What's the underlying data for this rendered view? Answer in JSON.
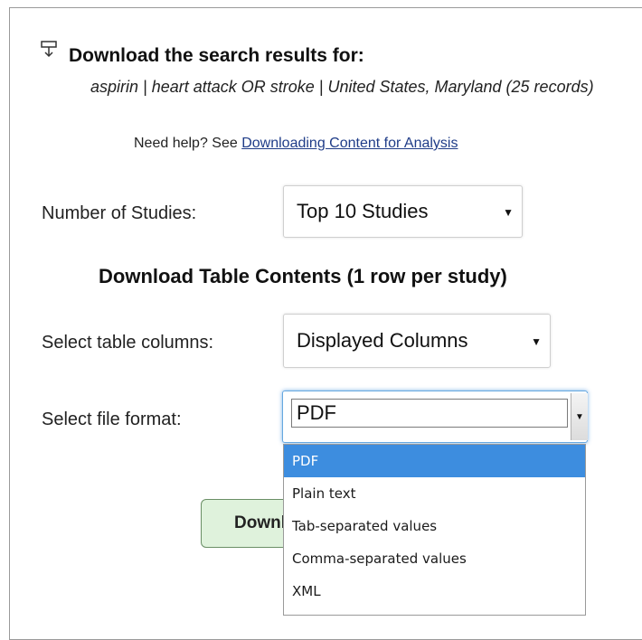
{
  "header": {
    "title": "Download the search results for:",
    "query": "aspirin | heart attack OR stroke | United States, Maryland (25 records)",
    "help_prefix": "Need help? See",
    "help_link": "Downloading Content for Analysis"
  },
  "number_of_studies": {
    "label": "Number of Studies:",
    "value": "Top 10 Studies"
  },
  "section_heading": "Download Table Contents (1 row per study)",
  "table_columns": {
    "label": "Select table columns:",
    "value": "Displayed Columns"
  },
  "file_format": {
    "label": "Select file format:",
    "value": "PDF",
    "options": [
      "PDF",
      "Plain text",
      "Tab-separated values",
      "Comma-separated values",
      "XML"
    ],
    "selected_index": 0
  },
  "download_button": {
    "label": "Download"
  },
  "colors": {
    "link": "#1f3c88",
    "highlight": "#3d8ddf",
    "button_bg": "#dff2dc",
    "focus": "#66a8e0"
  },
  "icons": {
    "title_icon": "download-icon",
    "select_caret": "caret-down-icon"
  }
}
